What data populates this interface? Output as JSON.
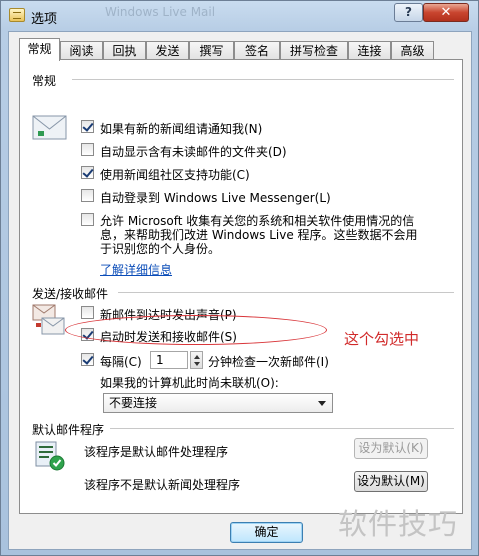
{
  "window": {
    "title": "选项",
    "title_ghost": "Windows Live Mail",
    "help_label": "?",
    "close_label": "✕"
  },
  "tabs": [
    {
      "label": "常规",
      "active": true
    },
    {
      "label": "阅读"
    },
    {
      "label": "回执"
    },
    {
      "label": "发送"
    },
    {
      "label": "撰写"
    },
    {
      "label": "签名"
    },
    {
      "label": "拼写检查"
    },
    {
      "label": "连接"
    },
    {
      "label": "高级"
    }
  ],
  "general": {
    "title": "常规",
    "options": [
      {
        "label": "如果有新的新闻组请通知我(N)",
        "checked": true
      },
      {
        "label": "自动显示含有未读邮件的文件夹(D)",
        "checked": false
      },
      {
        "label": "使用新闻组社区支持功能(C)",
        "checked": true
      },
      {
        "label": "自动登录到 Windows Live Messenger(L)",
        "checked": false
      }
    ],
    "privacy_option": {
      "lines": [
        "允许 Microsoft 收集有关您的系统和相关软件使用情况的信",
        "息，来帮助我们改进 Windows Live 程序。这些数据不会用",
        "于识别您的个人身份。"
      ],
      "checked": false
    },
    "details_link": "了解详细信息"
  },
  "send_receive": {
    "title": "发送/接收邮件",
    "options": [
      {
        "label": "新邮件到达时发出声音(P)",
        "checked": false
      },
      {
        "label": "启动时发送和接收邮件(S)",
        "checked": true
      }
    ],
    "check_every": {
      "label": "每隔(C)",
      "checked": true,
      "value": "1",
      "suffix": "分钟检查一次新邮件(I)"
    },
    "offline_label": "如果我的计算机此时尚未联机(O):",
    "offline_selected": "不要连接"
  },
  "default_mail": {
    "title": "默认邮件程序",
    "mail_text": "该程序是默认邮件处理程序",
    "mail_button": "设为默认(K)",
    "news_text": "该程序不是默认新闻处理程序",
    "news_button": "设为默认(M)"
  },
  "footer": {
    "ok_button": "确定"
  },
  "annotation": {
    "note": "这个勾选中"
  },
  "watermark": "软件技巧",
  "colors": {
    "annotation": "#d9373b",
    "link": "#0a4cb8",
    "title_bar": "#c9dcef"
  }
}
